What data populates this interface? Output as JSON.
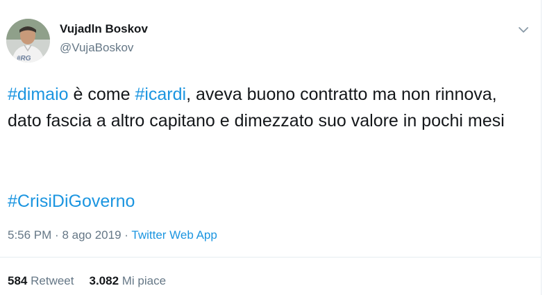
{
  "tweet": {
    "author": {
      "display_name": "Vujadln Boskov",
      "handle": "@VujaBoskov",
      "avatar_badge": "#RG"
    },
    "text_parts": [
      {
        "text": "#dimaio",
        "type": "hashtag"
      },
      {
        "text": " è come ",
        "type": "text"
      },
      {
        "text": "#icardi",
        "type": "hashtag"
      },
      {
        "text": ", aveva buono contratto ma non rinnova, dato fascia a altro capitano e dimezzato suo valore in pochi mesi",
        "type": "text"
      }
    ],
    "hashtag_line": "#CrisiDiGoverno",
    "time": "5:56 PM",
    "separator": "·",
    "date": "8 ago 2019",
    "source": "Twitter Web App",
    "retweets_count": "584",
    "retweets_label": "Retweet",
    "likes_count": "3.082",
    "likes_label": "Mi piace"
  },
  "colors": {
    "link": "#1b95e0",
    "secondary_text": "#657786",
    "primary_text": "#14171a",
    "divider": "#e6ecf0"
  },
  "icons": {
    "menu": "chevron-down-icon"
  }
}
